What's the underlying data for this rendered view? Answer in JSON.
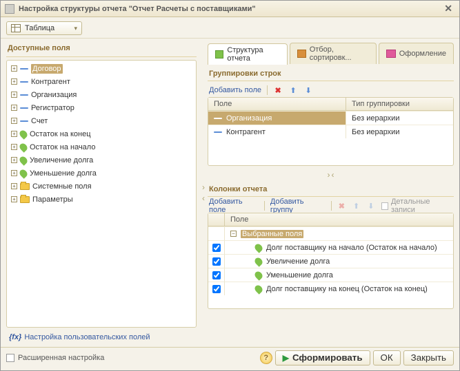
{
  "window": {
    "title": "Настройка структуры отчета \"Отчет  Расчеты с поставщиками\""
  },
  "table_selector": {
    "label": "Таблица"
  },
  "left": {
    "title": "Доступные поля",
    "fields": [
      {
        "label": "Договор",
        "icon": "dash",
        "selected": true
      },
      {
        "label": "Контрагент",
        "icon": "dash"
      },
      {
        "label": "Организация",
        "icon": "dash"
      },
      {
        "label": "Регистратор",
        "icon": "dash"
      },
      {
        "label": "Счет",
        "icon": "dash"
      },
      {
        "label": "Остаток на конец",
        "icon": "leaf"
      },
      {
        "label": "Остаток на начало",
        "icon": "leaf"
      },
      {
        "label": "Увеличение долга",
        "icon": "leaf"
      },
      {
        "label": "Уменьшение долга",
        "icon": "leaf"
      },
      {
        "label": "Системные поля",
        "icon": "folder"
      },
      {
        "label": "Параметры",
        "icon": "folder"
      }
    ],
    "user_fields_label": "Настройка пользовательских полей"
  },
  "tabs": [
    {
      "label": "Структура отчета"
    },
    {
      "label": "Отбор, сортировк..."
    },
    {
      "label": "Оформление"
    }
  ],
  "groupings": {
    "title": "Группировки строк",
    "add_field": "Добавить поле",
    "headers": {
      "field": "Поле",
      "type": "Тип группировки"
    },
    "rows": [
      {
        "field": "Организация",
        "type": "Без иерархии",
        "selected": true
      },
      {
        "field": "Контрагент",
        "type": "Без иерархии"
      }
    ]
  },
  "columns": {
    "title": "Колонки отчета",
    "add_field": "Добавить поле",
    "add_group": "Добавить группу",
    "detail_label": "Детальные записи",
    "header_field": "Поле",
    "root_label": "Выбранные поля",
    "rows": [
      {
        "label": "Долг поставщику на начало (Остаток на начало)"
      },
      {
        "label": "Увеличение долга"
      },
      {
        "label": "Уменьшение долга"
      },
      {
        "label": "Долг поставщику на конец (Остаток на конец)"
      }
    ]
  },
  "footer": {
    "advanced": "Расширенная настройка",
    "form": "Сформировать",
    "ok": "ОК",
    "close": "Закрыть"
  }
}
